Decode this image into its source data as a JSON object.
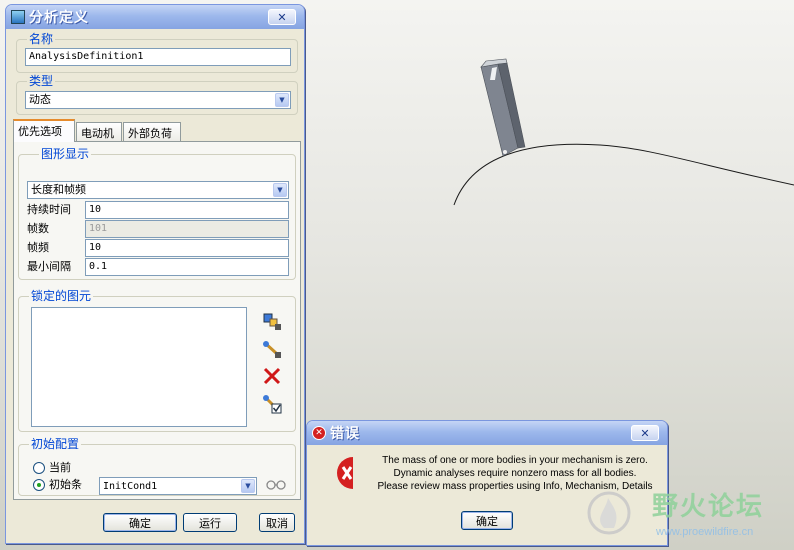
{
  "dialog": {
    "title": "分析定义",
    "name_group_label": "名称",
    "name_value": "AnalysisDefinition1",
    "type_group_label": "类型",
    "type_value": "动态",
    "tabs": [
      {
        "label": "优先选项",
        "active": true
      },
      {
        "label": "电动机",
        "active": false
      },
      {
        "label": "外部负荷",
        "active": false
      }
    ],
    "graphics_group_label": "图形显示",
    "graphics_mode": "长度和帧频",
    "fields": [
      {
        "label": "持续时间",
        "value": "10",
        "disabled": false
      },
      {
        "label": "帧数",
        "value": "101",
        "disabled": true
      },
      {
        "label": "帧频",
        "value": "10",
        "disabled": false
      },
      {
        "label": "最小间隔",
        "value": "0.1",
        "disabled": false
      }
    ],
    "locked_group_label": "锁定的图元",
    "locked_tools": [
      "lock-body-icon",
      "lock-joint-icon",
      "delete-icon",
      "enable-connection-icon"
    ],
    "init_group_label": "初始配置",
    "init_options": [
      {
        "label": "当前",
        "selected": false
      },
      {
        "label": "初始条",
        "selected": true
      }
    ],
    "init_cond_value": "InitCond1",
    "buttons": {
      "ok": "确定",
      "run": "运行",
      "cancel": "取消"
    }
  },
  "error_dialog": {
    "title": "错误",
    "lines": [
      "The mass of one or more bodies in your mechanism is zero.",
      "Dynamic analyses require nonzero mass for all bodies.",
      "Please review mass properties using Info, Mechanism, Details"
    ],
    "ok_label": "确定"
  },
  "watermark": {
    "name": "野火论坛",
    "url": "www.proewildfire.cn"
  },
  "colors": {
    "title_bar": "#9db8ec",
    "dialog_bg": "#ece9d8",
    "group_label": "#0046d5",
    "error_icon": "#d42020",
    "beam": "#7f8590"
  }
}
